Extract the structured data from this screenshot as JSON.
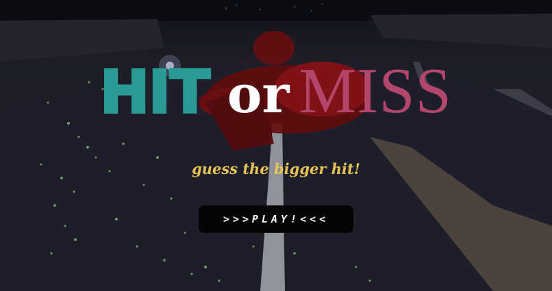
{
  "title": {
    "hit": "HIT",
    "or": "or",
    "miss": "MISS"
  },
  "tagline": "guess the bigger hit!",
  "play_button": {
    "label": ">>>PLAY!<<<"
  },
  "colors": {
    "hit": "#2a9a94",
    "or": "#ffffff",
    "miss": "#b4466d",
    "tagline": "#e7c255",
    "button_bg": "#050505"
  }
}
